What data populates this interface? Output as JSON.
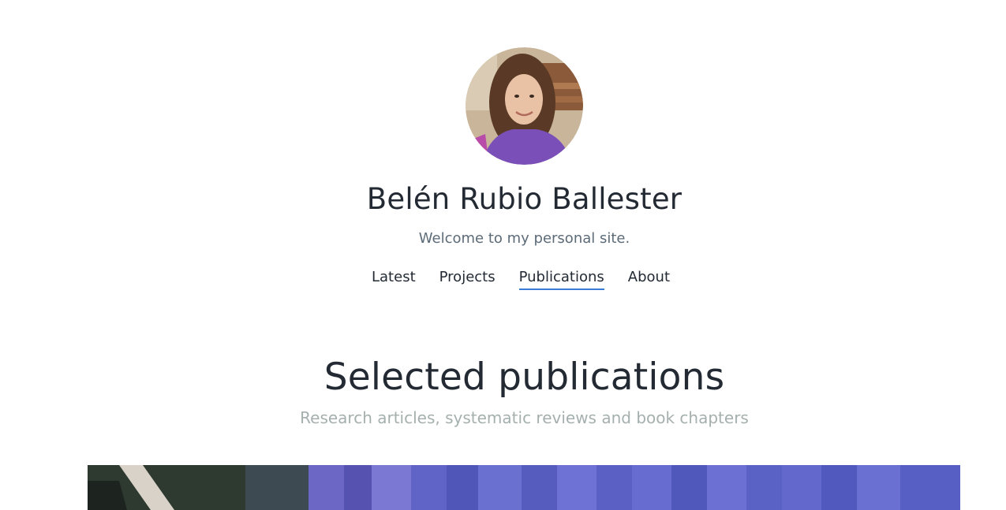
{
  "header": {
    "name": "Belén Rubio Ballester",
    "tagline": "Welcome to my personal site."
  },
  "nav": {
    "items": [
      {
        "label": "Latest",
        "active": false
      },
      {
        "label": "Projects",
        "active": false
      },
      {
        "label": "Publications",
        "active": true
      },
      {
        "label": "About",
        "active": false
      }
    ]
  },
  "section": {
    "title": "Selected publications",
    "subtitle": "Research articles, systematic reviews and book chapters"
  },
  "colors": {
    "text": "#232a33",
    "tagline": "#5c6b78",
    "subtitle": "#a5b0ae",
    "active_underline": "#3b7bd8",
    "hero_blue": "#5a62c8"
  }
}
